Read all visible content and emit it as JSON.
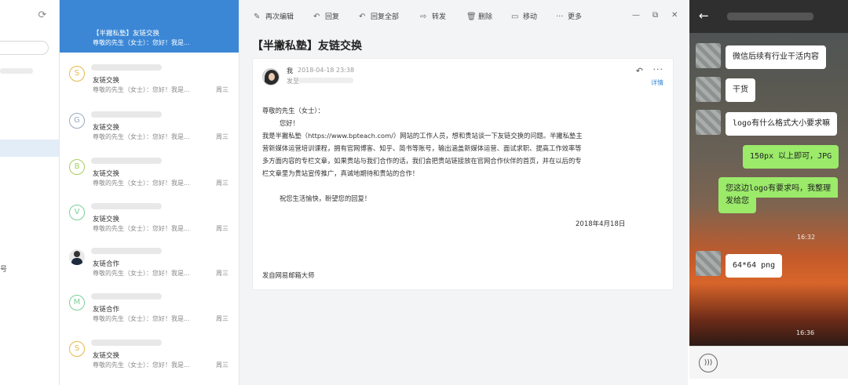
{
  "nav": {
    "refresh_icon": "refresh-icon",
    "label": "号"
  },
  "mail_list": [
    {
      "avatar_letter": "",
      "subject": "【半撇私塾】友链交换",
      "preview": "尊敬的先生（女士）：您好！我是...",
      "day": "",
      "selected": true
    },
    {
      "avatar_letter": "S",
      "avatar_color": "#e6b84a",
      "subject": "友链交换",
      "preview": "尊敬的先生（女士）：您好！我是...",
      "day": "周三"
    },
    {
      "avatar_letter": "G",
      "avatar_color": "#9aa9bd",
      "subject": "友链交换",
      "preview": "尊敬的先生（女士）：您好！我是...",
      "day": "周三"
    },
    {
      "avatar_letter": "B",
      "avatar_color": "#a6cf5b",
      "subject": "友链交换",
      "preview": "尊敬的先生（女士）：您好！我是...",
      "day": "周三"
    },
    {
      "avatar_letter": "V",
      "avatar_color": "#7ccf9a",
      "subject": "友链交换",
      "preview": "尊敬的先生（女士）：您好！我是...",
      "day": "周三"
    },
    {
      "avatar_letter": "",
      "avatar_photo": true,
      "subject": "友链合作",
      "preview": "尊敬的先生（女士）：您好！我是...",
      "day": "周三"
    },
    {
      "avatar_letter": "M",
      "avatar_color": "#7ccf9a",
      "subject": "友链合作",
      "preview": "尊敬的先生（女士）：您好！我是...",
      "day": "周三"
    },
    {
      "avatar_letter": "S",
      "avatar_color": "#e6b84a",
      "subject": "友链交换",
      "preview": "尊敬的先生（女士）：您好！我是...",
      "day": "周三"
    }
  ],
  "toolbar": {
    "reedit": "再次编辑",
    "reply": "回复",
    "reply_all": "回复全部",
    "forward": "转发",
    "delete": "删除",
    "move": "移动",
    "more": "更多",
    "reedit_icon": "edit-icon",
    "reply_icon": "reply-icon",
    "reply_all_icon": "reply-all-icon",
    "forward_icon": "forward-icon",
    "delete_icon": "trash-icon",
    "move_icon": "folder-move-icon",
    "more_icon": "more-icon"
  },
  "window": {
    "minimize": "—",
    "maximize": "⧉",
    "close": "✕"
  },
  "email": {
    "title": "【半撇私塾】友链交换",
    "from": "我",
    "time": "2018-04-18 23:38",
    "to_label": "发至",
    "detail": "详情",
    "greeting": "尊敬的先生（女士）：",
    "hello": "您好！",
    "body_lines": [
      "我是半撇私塾（https://www.bpteach.com/）网站的工作人员，想和贵站谈一下友链交换的问题。半撇私塾主",
      "营新媒体运营培训课程，拥有官网博客、知乎、简书等账号，输出涵盖新媒体运营、面试求职、提高工作效率等",
      "多方面内容的专栏文章，如果贵站与我们合作的话，我们会把贵站链接放在官网合作伙伴的首页，并在以后的专",
      "栏文章里为贵站宣传推广，真诚地期待和贵站的合作！"
    ],
    "closing": "祝您生活愉快，盼望您的回复！",
    "date": "2018年4月18日",
    "footer": "发自网易邮箱大师"
  },
  "chat": {
    "back_icon": "back-arrow-icon",
    "messages": [
      {
        "side": "in",
        "text": "微信后续有行业干活内容"
      },
      {
        "side": "in",
        "text": "干货"
      },
      {
        "side": "in",
        "text": "logo有什么格式大小要求嘛"
      },
      {
        "side": "out",
        "text": "150px 以上即可，JPG"
      },
      {
        "side": "out",
        "text": "您这边logo有要求吗，我整理"
      },
      {
        "side": "out",
        "text": "发给您"
      },
      {
        "side": "in",
        "text": "64*64  png"
      }
    ],
    "timestamps": [
      "16:32",
      "16:36"
    ],
    "voice_icon": "voice-icon"
  }
}
